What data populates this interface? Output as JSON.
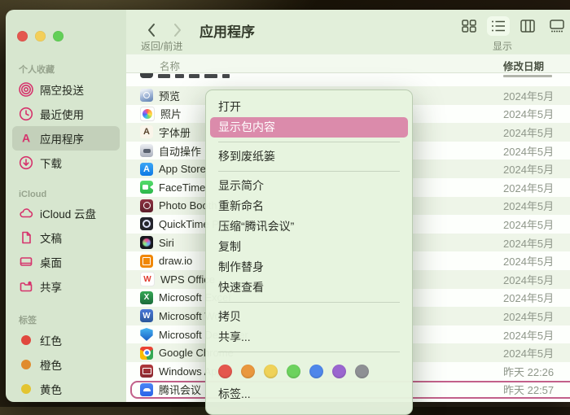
{
  "toolbar": {
    "title": "应用程序",
    "back_forward_label": "返回/前进",
    "display_label": "显示",
    "views": [
      "grid",
      "list",
      "columns",
      "gallery"
    ],
    "selected_view": "list"
  },
  "sidebar": {
    "sections": [
      {
        "header": "个人收藏",
        "items": [
          {
            "icon": "airdrop-icon",
            "label": "隔空投送"
          },
          {
            "icon": "clock-icon",
            "label": "最近使用"
          },
          {
            "icon": "applications-icon",
            "label": "应用程序",
            "selected": true
          },
          {
            "icon": "download-icon",
            "label": "下载"
          }
        ]
      },
      {
        "header": "iCloud",
        "items": [
          {
            "icon": "cloud-icon",
            "label": "iCloud 云盘"
          },
          {
            "icon": "document-icon",
            "label": "文稿"
          },
          {
            "icon": "desktop-icon",
            "label": "桌面"
          },
          {
            "icon": "shared-folder-icon",
            "label": "共享"
          }
        ]
      },
      {
        "header": "标签",
        "items": [
          {
            "icon": "red-tag-icon",
            "label": "红色",
            "color": "#e0483e"
          },
          {
            "icon": "orange-tag-icon",
            "label": "橙色",
            "color": "#e08b2d"
          },
          {
            "icon": "yellow-tag-icon",
            "label": "黄色",
            "color": "#e3c431"
          }
        ]
      }
    ]
  },
  "list": {
    "name_header": "名称",
    "date_header": "修改日期",
    "rows": [
      {
        "icon": "clipped-app-icon",
        "name": "",
        "date": "",
        "clipped": true
      },
      {
        "icon": "preview-app-icon",
        "name": "预览",
        "date": "2024年5月"
      },
      {
        "icon": "photos-app-icon",
        "name": "照片",
        "date": "2024年5月"
      },
      {
        "icon": "fontbook-app-icon",
        "name": "字体册",
        "date": "2024年5月"
      },
      {
        "icon": "automator-app-icon",
        "name": "自动操作",
        "date": "2024年5月"
      },
      {
        "icon": "appstore-app-icon",
        "name": "App Store",
        "date": "2024年5月"
      },
      {
        "icon": "facetime-app-icon",
        "name": "FaceTime",
        "date": "2024年5月"
      },
      {
        "icon": "photobooth-app-icon",
        "name": "Photo Booth",
        "date": "2024年5月"
      },
      {
        "icon": "quicktime-app-icon",
        "name": "QuickTime Player",
        "date": "2024年5月"
      },
      {
        "icon": "siri-app-icon",
        "name": "Siri",
        "date": "2024年5月"
      },
      {
        "icon": "drawio-app-icon",
        "name": "draw.io",
        "date": "2024年5月"
      },
      {
        "icon": "wps-app-icon",
        "name": "WPS Office",
        "date": "2024年5月"
      },
      {
        "icon": "excel-app-icon",
        "name": "Microsoft Excel",
        "date": "2024年5月"
      },
      {
        "icon": "word-app-icon",
        "name": "Microsoft Word",
        "date": "2024年5月"
      },
      {
        "icon": "defender-app-icon",
        "name": "Microsoft Defender",
        "date": "2024年5月"
      },
      {
        "icon": "chrome-app-icon",
        "name": "Google Chrome",
        "date": "2024年5月"
      },
      {
        "icon": "windowsapp-app-icon",
        "name": "Windows App",
        "date": "昨天 22:26"
      },
      {
        "icon": "tencent-meeting-app-icon",
        "name": "腾讯会议",
        "date": "昨天 22:57",
        "selected": true
      }
    ]
  },
  "context_menu": {
    "items": [
      {
        "label": "打开"
      },
      {
        "label": "显示包内容",
        "highlighted": true
      },
      {
        "sep": true
      },
      {
        "label": "移到废纸篓"
      },
      {
        "sep": true
      },
      {
        "label": "显示简介"
      },
      {
        "label": "重新命名"
      },
      {
        "label": "压缩“腾讯会议”"
      },
      {
        "label": "复制"
      },
      {
        "label": "制作替身"
      },
      {
        "label": "快速查看"
      },
      {
        "sep": true
      },
      {
        "label": "拷贝"
      },
      {
        "label": "共享..."
      },
      {
        "sep": true
      },
      {
        "colors": true
      },
      {
        "label": "标签..."
      }
    ],
    "tag_colors": [
      "#e4574d",
      "#e9973e",
      "#efd258",
      "#6dd25e",
      "#4f87ea",
      "#9a66cf",
      "#8e9094"
    ]
  },
  "colors": {
    "sidebar_accent": "#d6336c",
    "menu_highlight": "#db8bab",
    "selection_outline": "#c2608a"
  }
}
